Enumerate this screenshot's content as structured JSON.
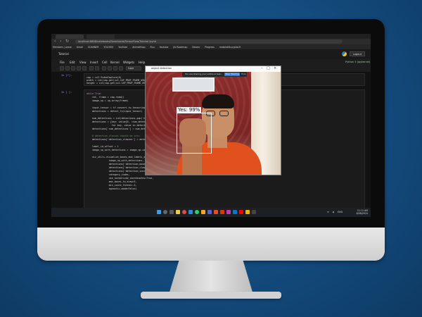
{
  "browser": {
    "url": "localhost:8888/notebooks/Downloads/TensorFlow/Tutorial.ipynb",
    "bookmarks": [
      "Members | prose",
      "Gmail",
      "SCANNER",
      "YOLOMO",
      "YouTube",
      "AnimeKhop",
      "Ruu",
      "Youtube",
      "Jib Roadmap",
      "Nearer",
      "Progress",
      "matplotlib.pyplot.fi"
    ]
  },
  "jupyter": {
    "title": "Tutorial",
    "logout": "Logout",
    "kernel": "Python 3 (ipykernel)",
    "menu": [
      "File",
      "Edit",
      "View",
      "Insert",
      "Cell",
      "Kernel",
      "Widgets",
      "Help"
    ],
    "cell_type": "Code"
  },
  "cells": [
    {
      "prompt": "In [*]:",
      "lines": [
        "cap = cv2.VideoCapture(0)",
        "width = int(cap.get(cv2.CAP_PROP_FRAME_WIDTH))",
        "height = int(cap.get(cv2.CAP_PROP_FRAME_HEIGHT))"
      ]
    },
    {
      "prompt": "In [ ]:",
      "lines": [
        "while True:",
        "    ret, frame = cap.read()",
        "    image_np = np.array(frame)",
        "",
        "    input_tensor = tf.convert_to_tensor(np.expand_dims(image_np, 0), dtype=tf.float32)",
        "    detections = detect_fn(input_tensor)",
        "",
        "    num_detections = int(detections.pop('num_detections'))",
        "    detections = {key: value[0, :num_detections].numpy()",
        "                  for key, value in detections.items()}",
        "    detections['num_detections'] = num_detections",
        "",
        "    # detection_classes should be ints.",
        "    detections['detection_classes'] = detections['detection_classes'].astype(np.int64)",
        "",
        "    label_id_offset = 1",
        "    image_np_with_detections = image_np.copy()",
        "",
        "    viz_utils.visualize_boxes_and_labels_on_image_array(",
        "                image_np_with_detections,",
        "                detections['detection_boxes'],",
        "                detections['detection_classes']+label_id_offset,",
        "                detections['detection_scores'],",
        "                category_index,",
        "                use_normalized_coordinates=True,",
        "                max_boxes_to_draw=5,",
        "                min_score_thresh=.5,",
        "                agnostic_mode=False)"
      ]
    }
  ],
  "detection_window": {
    "title": "object detection",
    "share_message": "You are sharing your entire screen.",
    "stop_button": "Stop Sharing",
    "hide": "Hide",
    "label": "Yes: 99%"
  },
  "taskbar": {
    "time": "11:11 AM",
    "date": "6/08/2024",
    "lang": "ENG"
  },
  "colors": {
    "background": "#134b7d",
    "bezel": "#0b0b0b",
    "shirt": "#e0511e",
    "wall": "#8d2b2b",
    "share_button": "#2f7de1"
  }
}
